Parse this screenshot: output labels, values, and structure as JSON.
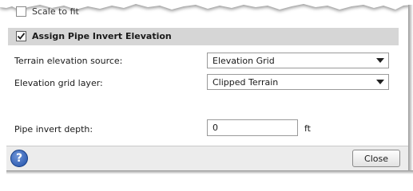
{
  "top_option": {
    "label": "Scale to fit",
    "checked": false
  },
  "section": {
    "title": "Assign Pipe Invert Elevation",
    "checked": true
  },
  "fields": {
    "terrain_source": {
      "label": "Terrain elevation source:",
      "value": "Elevation Grid"
    },
    "grid_layer": {
      "label": "Elevation grid layer:",
      "value": "Clipped Terrain"
    },
    "invert_depth": {
      "label": "Pipe invert depth:",
      "value": "0",
      "unit": "ft"
    }
  },
  "footer": {
    "help_symbol": "?",
    "close_label": "Close"
  },
  "colors": {
    "section_bg": "#d6d6d6",
    "footer_bg": "#ececec",
    "help_blue": "#2a5bb5"
  }
}
